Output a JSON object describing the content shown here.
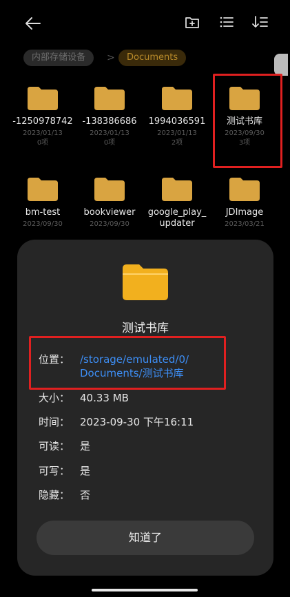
{
  "breadcrumb": {
    "root": "内部存储设备",
    "separator": ">",
    "current": "Documents"
  },
  "toolbar": {
    "back_icon": "arrow-left-icon",
    "new_folder_icon": "new-folder-icon",
    "list_view_icon": "list-view-icon",
    "sort_icon": "sort-icon"
  },
  "folders": [
    {
      "name": "-1250978742",
      "date": "2023/01/13",
      "count": "0项"
    },
    {
      "name": "-138386686",
      "date": "2023/01/13",
      "count": "0项"
    },
    {
      "name": "1994036591",
      "date": "2023/01/13",
      "count": "2项"
    },
    {
      "name": "测试书库",
      "date": "2023/09/30",
      "count": "3项"
    },
    {
      "name": "bm-test",
      "date": "2023/09/30"
    },
    {
      "name": "bookviewer",
      "date": "2023/09/30"
    },
    {
      "name": "google_play_",
      "name2": "updater"
    },
    {
      "name": "JDImage",
      "date": "2023/03/21"
    }
  ],
  "sheet": {
    "title": "测试书库",
    "location_label": "位置：",
    "location_line1": "/storage/emulated/0/",
    "location_line2": "Documents/测试书库",
    "size_label": "大小：",
    "size_value": "40.33 MB",
    "time_label": "时间：",
    "time_value": "2023-09-30 下午16:11",
    "readable_label": "可读：",
    "readable_value": "是",
    "writable_label": "可写：",
    "writable_value": "是",
    "hidden_label": "隐藏：",
    "hidden_value": "否",
    "ok_label": "知道了"
  },
  "colors": {
    "folder": "#d9a441",
    "accent_link": "#3d8ef5",
    "highlight": "#e02020",
    "sheet_bg": "#262626"
  }
}
